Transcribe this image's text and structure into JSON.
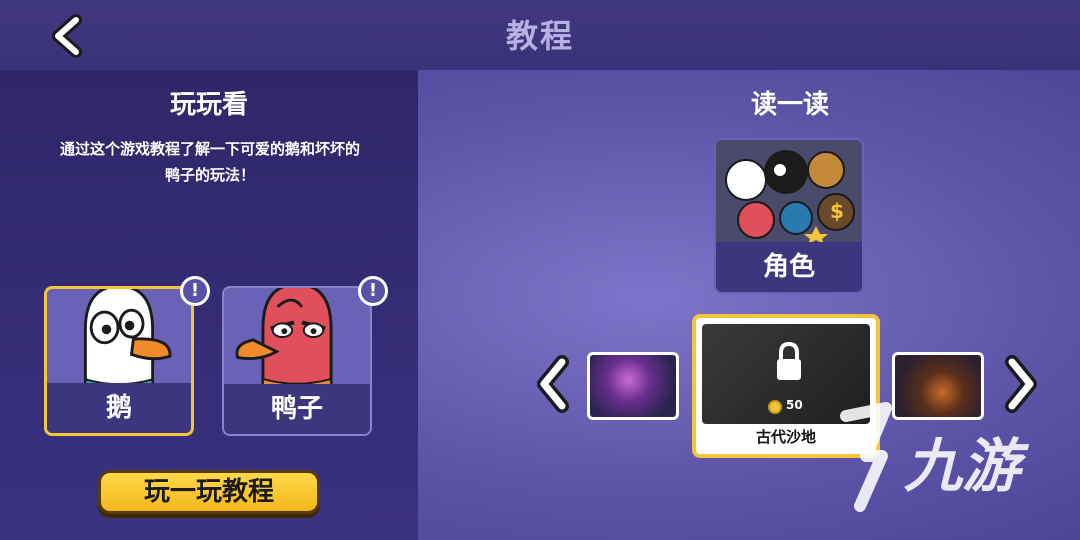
{
  "header": {
    "title": "教程",
    "back_icon": "chevron-left-icon"
  },
  "left_panel": {
    "title": "玩玩看",
    "description": "通过这个游戏教程了解一下可爱的鹅和坏坏的鸭子的玩法！",
    "characters": [
      {
        "label": "鹅",
        "badge": "!",
        "selected": true
      },
      {
        "label": "鸭子",
        "badge": "!",
        "selected": false
      }
    ],
    "play_button_label": "玩一玩教程"
  },
  "right_panel": {
    "title": "读一读",
    "role_card_label": "角色",
    "map_carousel": {
      "current_map_name": "古代沙地",
      "cost": "50",
      "locked": true
    }
  },
  "watermark": {
    "text": "九游"
  },
  "colors": {
    "accent_gold": "#f2c53a",
    "panel_dark": "#2f2768",
    "background_purple": "#6e66c0",
    "goose_white": "#ffffff",
    "duck_red": "#e0505a",
    "beak_orange": "#f08a2a"
  }
}
